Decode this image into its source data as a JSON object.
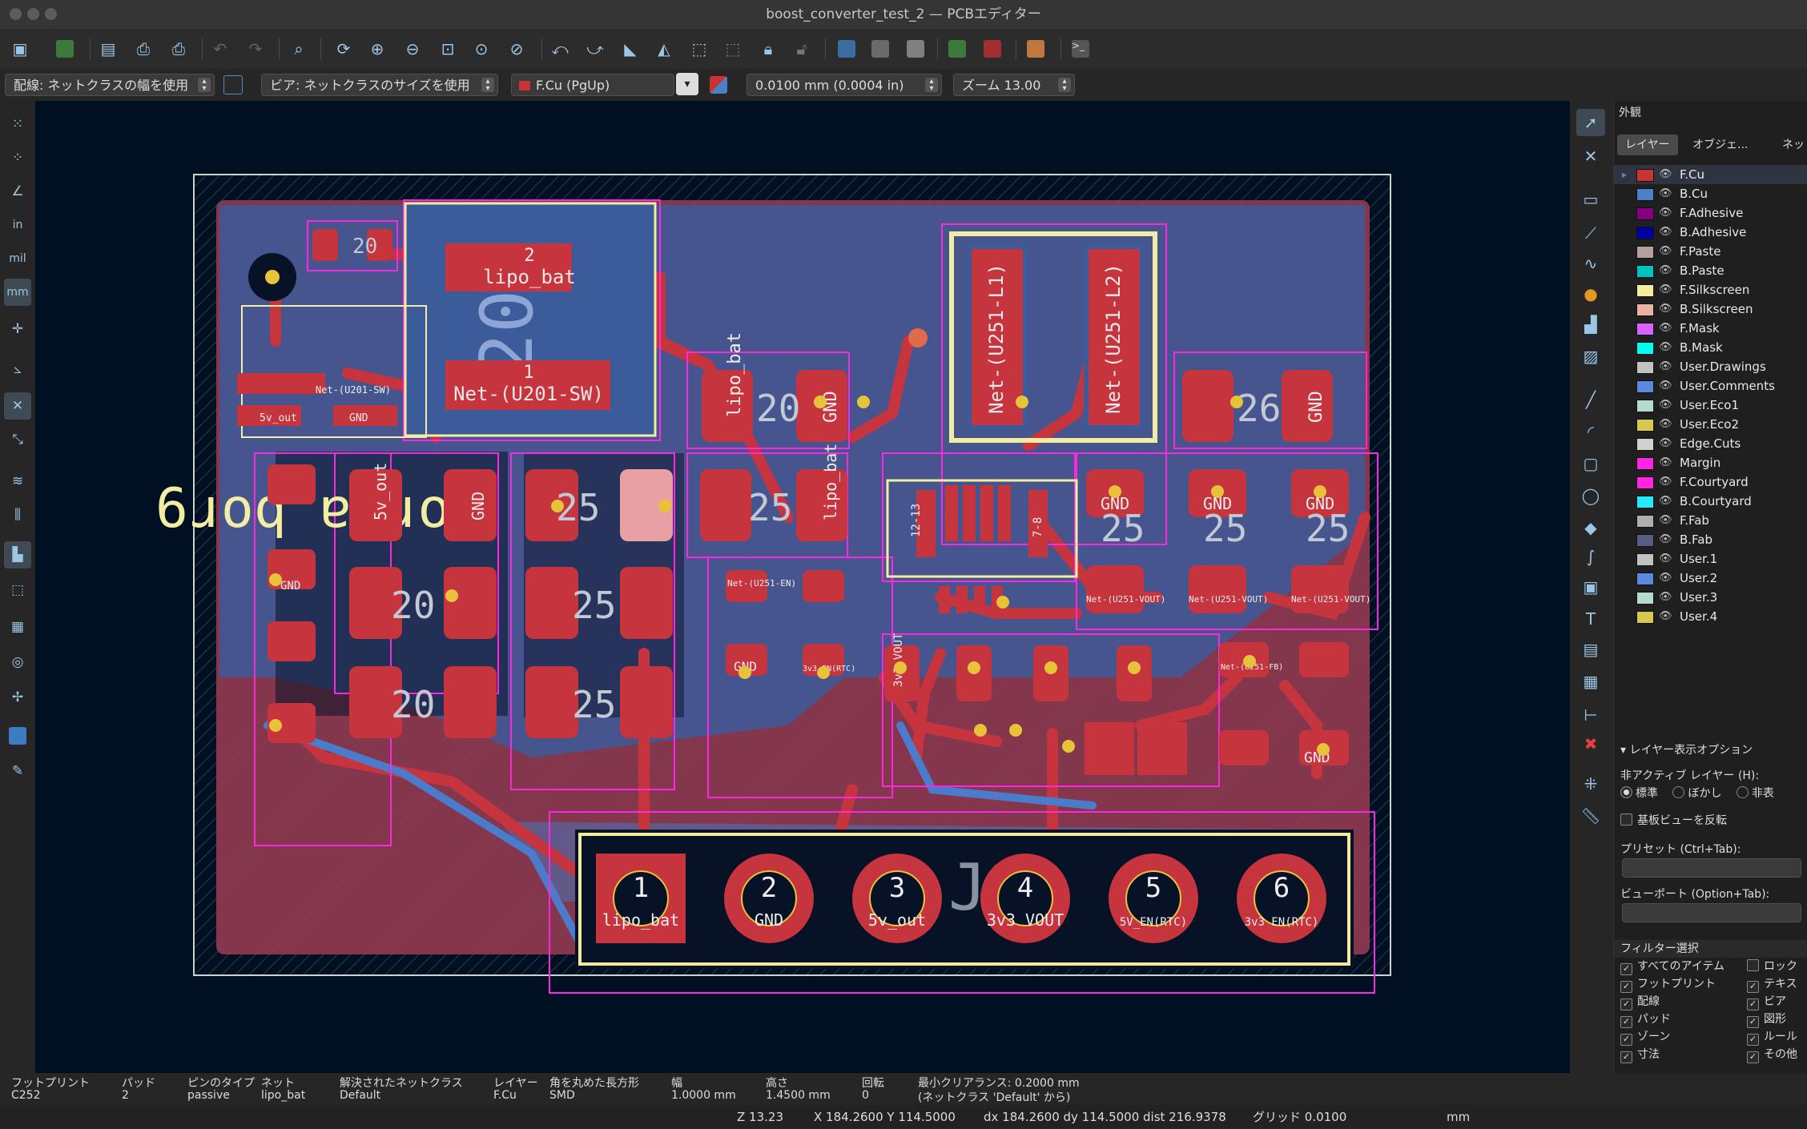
{
  "window": {
    "title": "boost_converter_test_2 — PCBエディター"
  },
  "options": {
    "track_width": "配線: ネットクラスの幅を使用",
    "via_size": "ビア: ネットクラスのサイズを使用",
    "layer": "F.Cu (PgUp)",
    "grid": "0.0100 mm (0.0004 in)",
    "zoom": "ズーム 13.00"
  },
  "left_toolbar": {
    "in": "in",
    "mil": "mil",
    "mm": "mm"
  },
  "board": {
    "silk_label": "6ɹoq ɐ ɹoɟ",
    "j1_ref": "J1",
    "pads": [
      {
        "num": "1",
        "net": "lipo_bat"
      },
      {
        "num": "2",
        "net": "GND"
      },
      {
        "num": "3",
        "net": "5v_out"
      },
      {
        "num": "4",
        "net": "3v3 VOUT"
      },
      {
        "num": "5",
        "net": "5V_EN(RTC)"
      },
      {
        "num": "6",
        "net": "3v3 EN(RTC)"
      }
    ],
    "inductor": {
      "p2": "2",
      "n2": "lipo_bat",
      "p1": "1",
      "n1": "Net-(U201-SW)",
      "val": "20"
    },
    "l251": {
      "n1": "Net-(U251-L1)",
      "n2": "Net-(U251-L2)"
    },
    "small_labels": {
      "p1": "1",
      "p2": "2",
      "gnd": "GND",
      "lipo": "lipo_bat",
      "fiveout": "5v_out",
      "v20": "20",
      "v25": "25",
      "v26": "26",
      "vout": "Net-(U251-VOUT)",
      "en": "Net-(U251-EN)",
      "sw": "Net-(U201-SW)",
      "fb": "Net-(U251-FB)",
      "v3": "3v3 VOUT",
      "v3rtc": "3v3 EN(RTC)",
      "v5rtc": "5V_EN(RTC)",
      "p1213": "12-13",
      "p78": "7-8"
    }
  },
  "appearance": {
    "title": "外観",
    "tabs": [
      "レイヤー",
      "オブジェ...",
      "ネット"
    ],
    "layers": [
      {
        "name": "F.Cu",
        "color": "#c83434"
      },
      {
        "name": "B.Cu",
        "color": "#4d7fc4"
      },
      {
        "name": "F.Adhesive",
        "color": "#84007f"
      },
      {
        "name": "B.Adhesive",
        "color": "#0000a0"
      },
      {
        "name": "F.Paste",
        "color": "#b4a09c"
      },
      {
        "name": "B.Paste",
        "color": "#00c2c2"
      },
      {
        "name": "F.Silkscreen",
        "color": "#f2eda1"
      },
      {
        "name": "B.Silkscreen",
        "color": "#e8b2a7"
      },
      {
        "name": "F.Mask",
        "color": "#d864ff"
      },
      {
        "name": "B.Mask",
        "color": "#02ffee"
      },
      {
        "name": "User.Drawings",
        "color": "#c2c2c2"
      },
      {
        "name": "User.Comments",
        "color": "#5989db"
      },
      {
        "name": "User.Eco1",
        "color": "#b4dbd2"
      },
      {
        "name": "User.Eco2",
        "color": "#d8c852"
      },
      {
        "name": "Edge.Cuts",
        "color": "#d0d2cd"
      },
      {
        "name": "Margin",
        "color": "#ff26e2"
      },
      {
        "name": "F.Courtyard",
        "color": "#ff26e2"
      },
      {
        "name": "B.Courtyard",
        "color": "#26e9ff"
      },
      {
        "name": "F.Fab",
        "color": "#afafaf"
      },
      {
        "name": "B.Fab",
        "color": "#585d84"
      },
      {
        "name": "User.1",
        "color": "#c2c2c2"
      },
      {
        "name": "User.2",
        "color": "#5989db"
      },
      {
        "name": "User.3",
        "color": "#b4dbd2"
      },
      {
        "name": "User.4",
        "color": "#d8c852"
      }
    ],
    "display_options": "レイヤー表示オプション",
    "inactive_label": "非アクティブ レイヤー (H):",
    "inactive_opts": [
      "標準",
      "ぼかし",
      "非表"
    ],
    "flip_board": "基板ビューを反転",
    "preset_label": "プリセット (Ctrl+Tab):",
    "viewport_label": "ビューポート (Option+Tab):",
    "filter_title": "フィルター選択",
    "filter_left": [
      "すべてのアイテム",
      "フットプリント",
      "配線",
      "パッド",
      "ゾーン",
      "寸法"
    ],
    "filter_right": [
      "ロック",
      "テキス",
      "ビア",
      "図形",
      "ルール",
      "その他"
    ]
  },
  "status": {
    "footprint_h": "フットプリント",
    "footprint_v": "C252",
    "pad_h": "パッド",
    "pad_v": "2",
    "pintype_h": "ピンのタイプ",
    "pintype_v": "passive",
    "net_h": "ネット",
    "net_v": "lipo_bat",
    "netclass_h": "解決されたネットクラス",
    "netclass_v": "Default",
    "layer_h": "レイヤー",
    "layer_v": "F.Cu",
    "shape_h": "角を丸めた長方形",
    "shape_v": "SMD",
    "width_h": "幅",
    "width_v": "1.0000 mm",
    "height_h": "高さ",
    "height_v": "1.4500 mm",
    "rot_h": "回転",
    "rot_v": "0",
    "clear_h": "最小クリアランス: 0.2000 mm",
    "clear_v": "(ネットクラス 'Default' から)"
  },
  "bottom": {
    "z": "Z 13.23",
    "xy": "X 184.2600  Y 114.5000",
    "dxy": "dx 184.2600  dy 114.5000  dist 216.9378",
    "grid": "グリッド 0.0100",
    "units": "mm"
  }
}
